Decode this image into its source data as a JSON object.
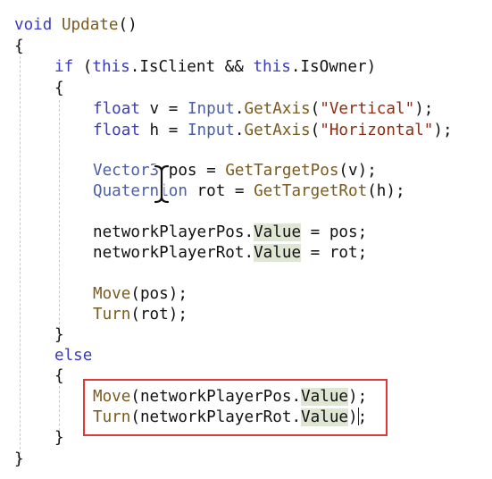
{
  "code": {
    "l1": {
      "kw": "void",
      "fn": "Update",
      "rest": "()"
    },
    "l2": {
      "text": "{"
    },
    "l3": {
      "kw1": "if",
      "p1": " (",
      "kw2": "this",
      "p2": ".IsClient && ",
      "kw3": "this",
      "p3": ".IsOwner)"
    },
    "l4": {
      "text": "{"
    },
    "l5": {
      "type": "float",
      "p1": " v = ",
      "cls": "Input",
      "dot": ".",
      "fn": "GetAxis",
      "p2": "(",
      "str": "\"Vertical\"",
      "p3": ");"
    },
    "l6": {
      "type": "float",
      "p1": " h = ",
      "cls": "Input",
      "dot": ".",
      "fn": "GetAxis",
      "p2": "(",
      "str": "\"Horizontal\"",
      "p3": ");"
    },
    "l7": {
      "type": "Vector3",
      "p1": " pos = ",
      "fn": "GetTargetPos",
      "p2": "(v);"
    },
    "l8": {
      "type": "Quaternion",
      "p1": " rot = ",
      "fn": "GetTargetRot",
      "p2": "(h);"
    },
    "l9": {
      "obj": "networkPlayerPos.",
      "prop": "Value",
      "rest": " = pos;"
    },
    "l10": {
      "obj": "networkPlayerRot.",
      "prop": "Value",
      "rest": " = rot;"
    },
    "l11": {
      "fn": "Move",
      "rest": "(pos);"
    },
    "l12": {
      "fn": "Turn",
      "rest": "(rot);"
    },
    "l13": {
      "text": "}"
    },
    "l14": {
      "kw": "else"
    },
    "l15": {
      "text": "{"
    },
    "l16": {
      "fn": "Move",
      "p1": "(networkPlayerPos.",
      "prop": "Value",
      "p2": ");"
    },
    "l17": {
      "fn": "Turn",
      "p1": "(networkPlayerRot.",
      "prop": "Value",
      "p2": ");"
    },
    "l18": {
      "text": "}"
    },
    "l19": {
      "text": "}"
    }
  },
  "colors": {
    "keyword": "#3b3bbf",
    "type": "#4a5fa6",
    "method": "#7a5a1e",
    "string": "#8b2d12",
    "value_highlight": "#dfe6d3",
    "annotation_box": "#e0383a"
  },
  "icons": {
    "text_cursor": "i-beam-cursor-icon"
  }
}
